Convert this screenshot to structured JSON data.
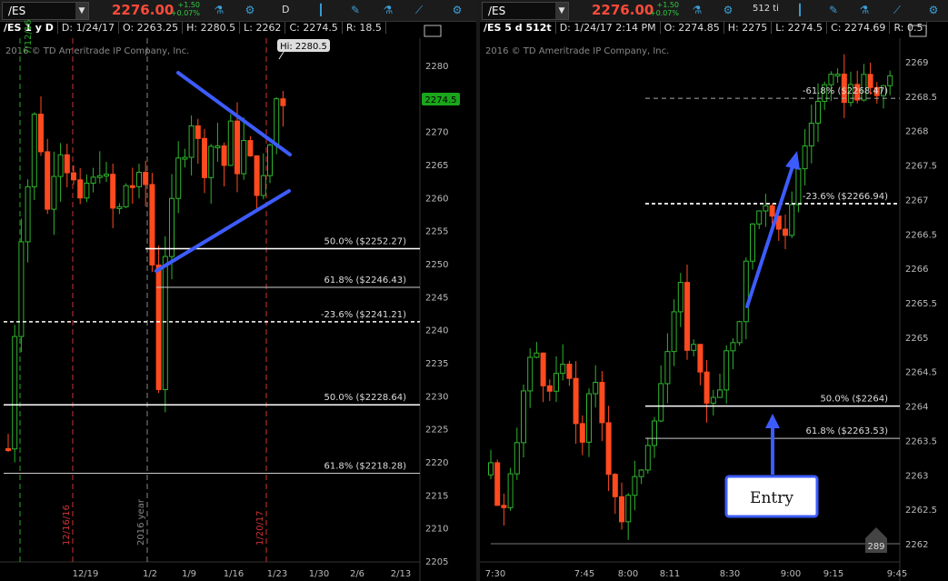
{
  "left": {
    "symbol": "/ES",
    "price": "2276.00",
    "change": "+1.50",
    "change_pct": "+0.07%",
    "aggregation": "D",
    "info": {
      "sym": "/ES 1 y D",
      "date": "D: 1/24/17",
      "open": "O: 2263.25",
      "high": "H: 2280.5",
      "low": "L: 2262",
      "close": "C: 2274.5",
      "range": "R: 18.5"
    },
    "copyright": "2016 © TD Ameritrade IP Company, Inc.",
    "hi_label": "Hi: 2280.5",
    "last_label": "2274.5",
    "y_ticks": [
      "2280",
      "2275",
      "2270",
      "2265",
      "2260",
      "2255",
      "2250",
      "2245",
      "2240",
      "2235",
      "2230",
      "2225",
      "2220",
      "2215",
      "2210",
      "2205"
    ],
    "x_ticks": [
      "12/19",
      "1/2",
      "1/9",
      "1/16",
      "1/23",
      "1/30",
      "2/6",
      "2/13"
    ],
    "vlines": [
      "12/16/16",
      "2016 year",
      "1/20/17"
    ],
    "fib_labels": [
      "50.0%  ($2252.27)",
      "61.8%  ($2246.43)",
      "-23.6%  ($2241.21)",
      "50.0%  ($2228.64)",
      "61.8%  ($2218.28)"
    ],
    "extra_label": "7/12/16"
  },
  "right": {
    "symbol": "/ES",
    "price": "2276.00",
    "change": "+1.50",
    "change_pct": "+0.07%",
    "aggregation": "512 ti",
    "info": {
      "sym": "/ES 5 d 512t",
      "date": "D: 1/24/17 2:14 PM",
      "open": "O: 2274.85",
      "high": "H: 2275",
      "low": "L: 2274.5",
      "close": "C: 2274.69",
      "range": "R: 0.5"
    },
    "copyright": "2016 © TD Ameritrade IP Company, Inc.",
    "y_ticks": [
      "2269",
      "2268.5",
      "2268",
      "2267.5",
      "2267",
      "2266.5",
      "2266",
      "2265.5",
      "2265",
      "2264.5",
      "2264",
      "2263.5",
      "2263",
      "2262.5",
      "2262"
    ],
    "x_ticks": [
      "7:30",
      "7:45",
      "8:00",
      "8:11",
      "8:30",
      "9:00",
      "9:15",
      "9:45"
    ],
    "fib_labels": [
      "-61.8%  ($2268.47)",
      "-23.6%  ($2266.94)",
      "50.0%  ($2264)",
      "61.8%  ($2263.53)"
    ],
    "entry_label": "Entry",
    "badge": "289"
  },
  "colors": {
    "up": "#2fb52f",
    "down": "#ff4a1f",
    "blue": "#3d5cff",
    "last": "#1aa51a"
  },
  "chart_data": [
    {
      "type": "candlestick",
      "title": "/ES 1 y D",
      "ylim": [
        2205,
        2282
      ],
      "x_ticks": [
        "12/19",
        "1/2",
        "1/9",
        "1/16",
        "1/23",
        "1/30",
        "2/6",
        "2/13"
      ],
      "fib_levels": [
        {
          "label": "50.0%",
          "value": 2252.27
        },
        {
          "label": "61.8%",
          "value": 2246.43
        },
        {
          "label": "-23.6%",
          "value": 2241.21
        },
        {
          "label": "50.0%",
          "value": 2228.64
        },
        {
          "label": "61.8%",
          "value": 2218.28
        }
      ],
      "last": 2274.5,
      "high": 2280.5
    },
    {
      "type": "candlestick",
      "title": "/ES 5 d 512t",
      "ylim": [
        2261.9,
        2269.1
      ],
      "x_ticks": [
        "7:30",
        "7:45",
        "8:00",
        "8:11",
        "8:30",
        "9:00",
        "9:15",
        "9:45"
      ],
      "fib_levels": [
        {
          "label": "-61.8%",
          "value": 2268.47
        },
        {
          "label": "-23.6%",
          "value": 2266.94
        },
        {
          "label": "50.0%",
          "value": 2264
        },
        {
          "label": "61.8%",
          "value": 2263.53
        }
      ]
    }
  ]
}
